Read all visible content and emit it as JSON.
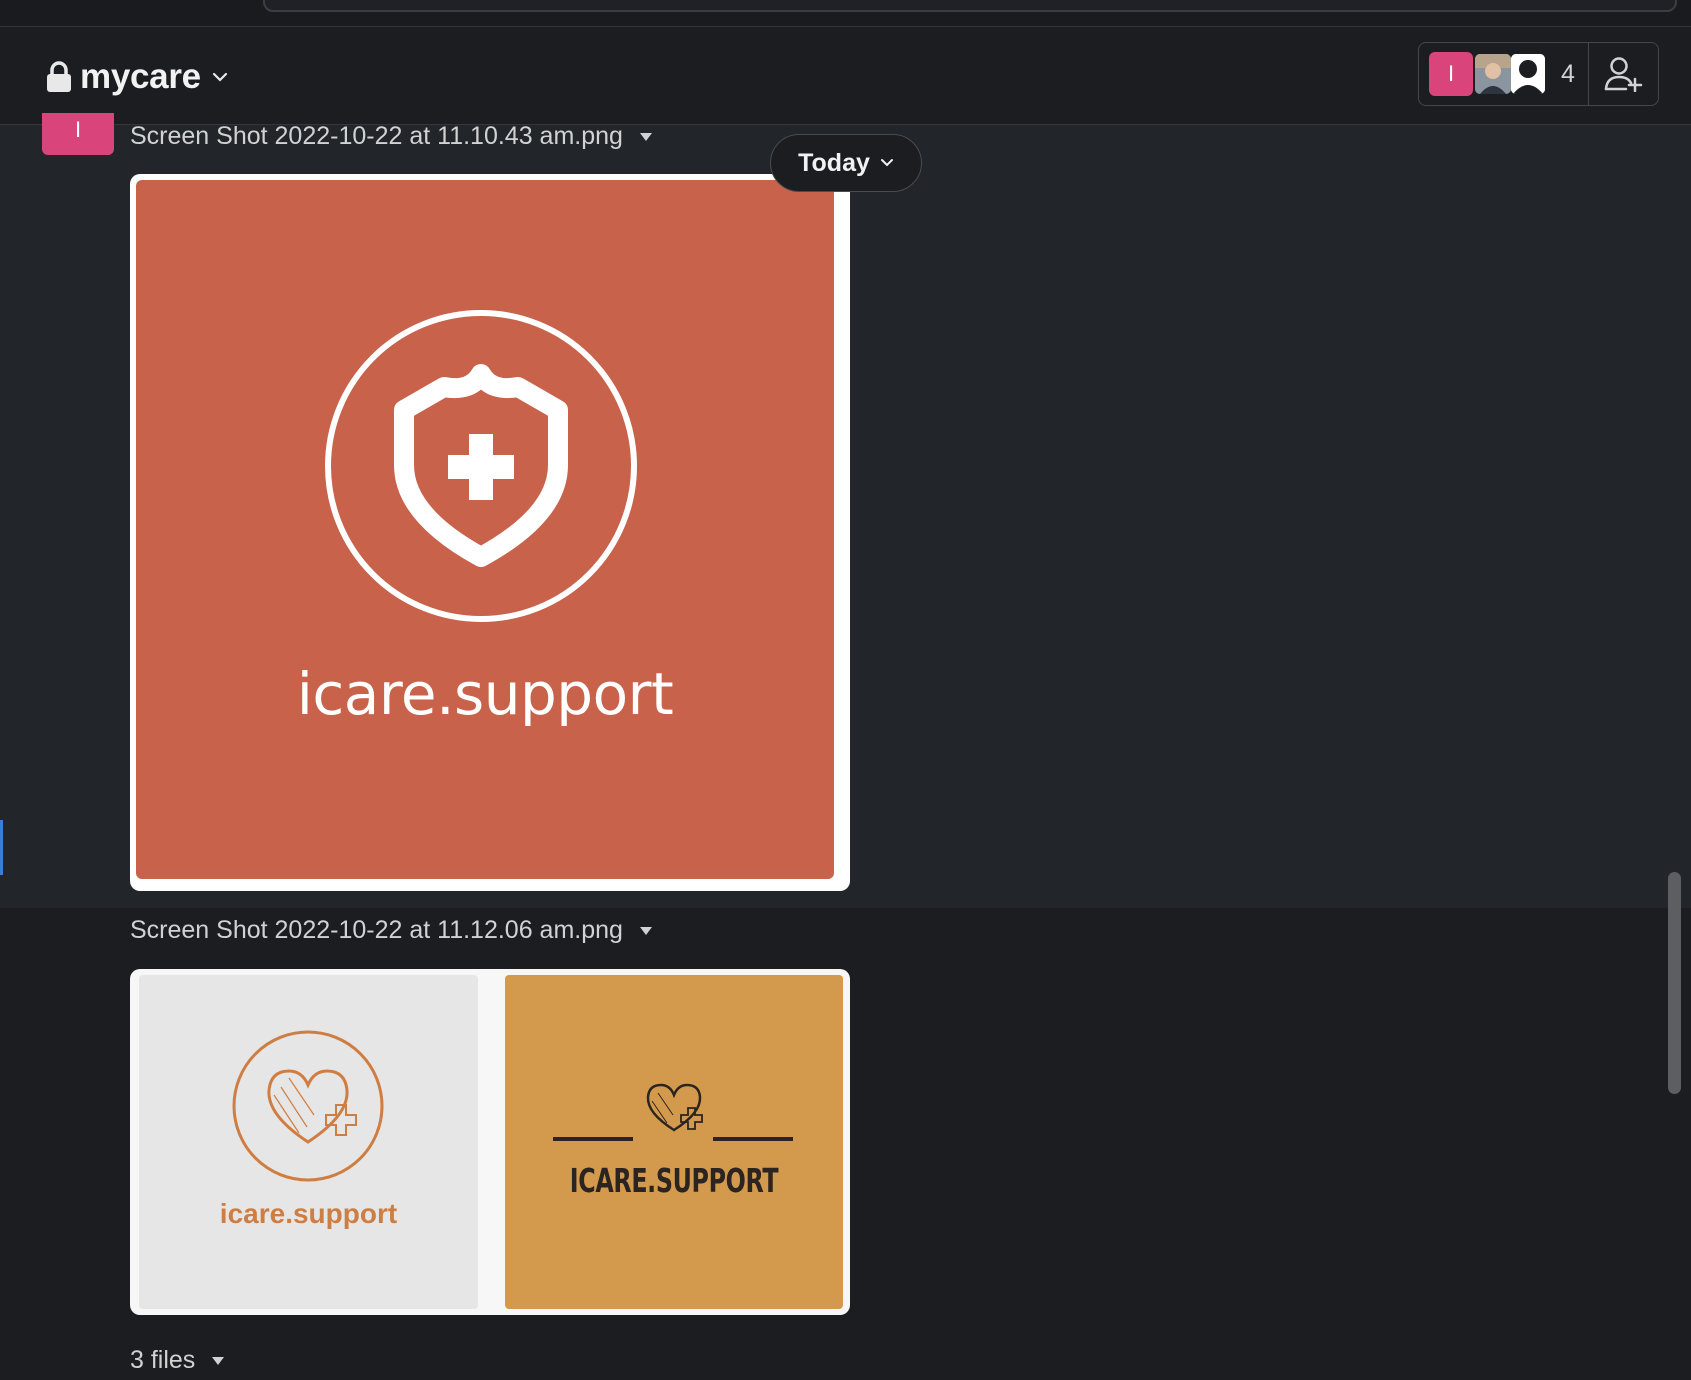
{
  "channel": {
    "name": "mycare",
    "member_count": "4",
    "avatar_initial": "I"
  },
  "messages": [
    {
      "sender_initial": "I",
      "file_name": "Screen Shot 2022-10-22 at 11.10.43 am.png",
      "image_text": "icare.support",
      "image_bg": "#c8624b"
    },
    {
      "file_name": "Screen Shot 2022-10-22 at 11.12.06 am.png",
      "tiles": [
        {
          "text": "icare.support",
          "bg": "#e6e6e6",
          "fg": "#cf7e43"
        },
        {
          "text": "ICARE.SUPPORT",
          "bg": "#d39a4d",
          "fg": "#2b2420"
        }
      ]
    }
  ],
  "date_divider": "Today",
  "files_summary": "3 files",
  "colors": {
    "accent_pink": "#d9457a",
    "bg": "#1c1d21",
    "highlight_bg": "#222529"
  }
}
